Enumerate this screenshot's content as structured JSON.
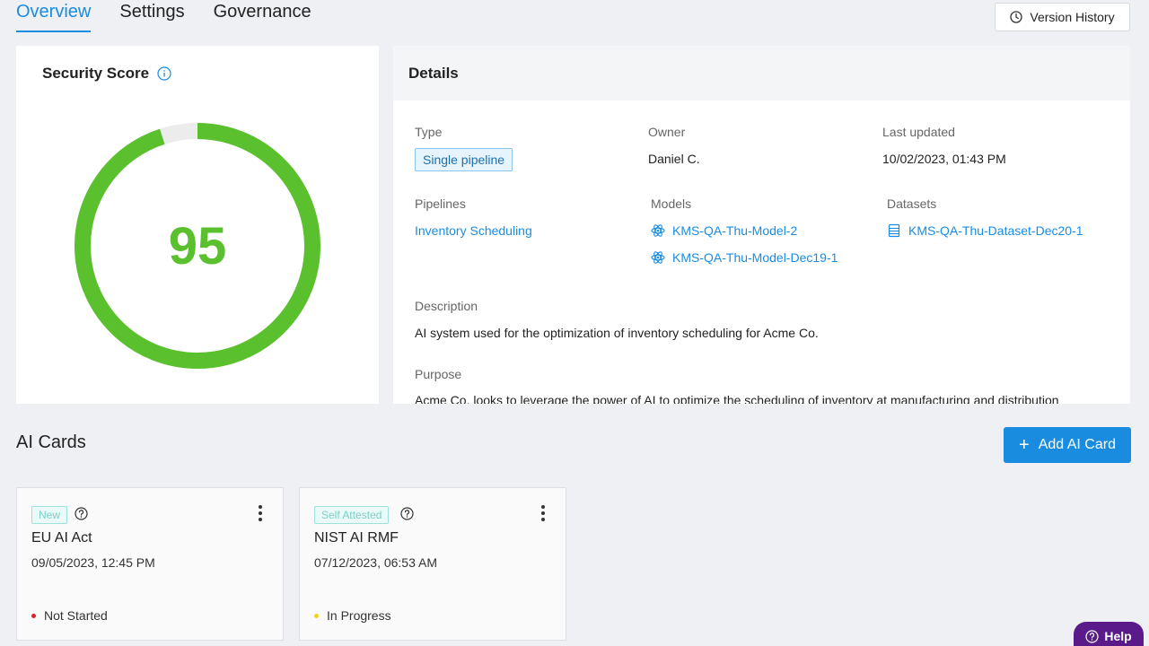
{
  "tabs": [
    {
      "label": "Overview",
      "active": true
    },
    {
      "label": "Settings",
      "active": false
    },
    {
      "label": "Governance",
      "active": false
    }
  ],
  "version_history_label": "Version History",
  "score_card": {
    "title": "Security Score",
    "value": "95",
    "score_percent": 95,
    "gauge_color": "#5ac02e",
    "track_color": "#ececec"
  },
  "details": {
    "title": "Details",
    "type_label": "Type",
    "type_value": "Single pipeline",
    "owner_label": "Owner",
    "owner_value": "Daniel C.",
    "last_updated_label": "Last updated",
    "last_updated_value": "10/02/2023, 01:43 PM",
    "pipelines_label": "Pipelines",
    "pipelines": [
      "Inventory Scheduling"
    ],
    "models_label": "Models",
    "models": [
      "KMS-QA-Thu-Model-2",
      "KMS-QA-Thu-Model-Dec19-1"
    ],
    "datasets_label": "Datasets",
    "datasets": [
      "KMS-QA-Thu-Dataset-Dec20-1"
    ],
    "description_label": "Description",
    "description_value": "AI system used for the optimization of inventory scheduling for Acme Co.",
    "purpose_label": "Purpose",
    "purpose_value": "Acme Co. looks to leverage the power of AI to optimize the scheduling of inventory at manufacturing and distribution"
  },
  "ai_cards": {
    "title": "AI Cards",
    "add_label": "Add AI Card",
    "cards": [
      {
        "badge": "New",
        "title": "EU AI Act",
        "date": "09/05/2023, 12:45 PM",
        "status": "Not Started",
        "status_color": "#e0202a"
      },
      {
        "badge": "Self Attested",
        "title": "NIST AI RMF",
        "date": "07/12/2023, 06:53 AM",
        "status": "In Progress",
        "status_color": "#f2d21b"
      }
    ]
  },
  "help_label": "Help",
  "icons": [
    "clock-icon",
    "info-icon",
    "atom-icon",
    "dataset-icon",
    "plus-icon",
    "question-circle-icon",
    "kebab-menu-icon"
  ]
}
